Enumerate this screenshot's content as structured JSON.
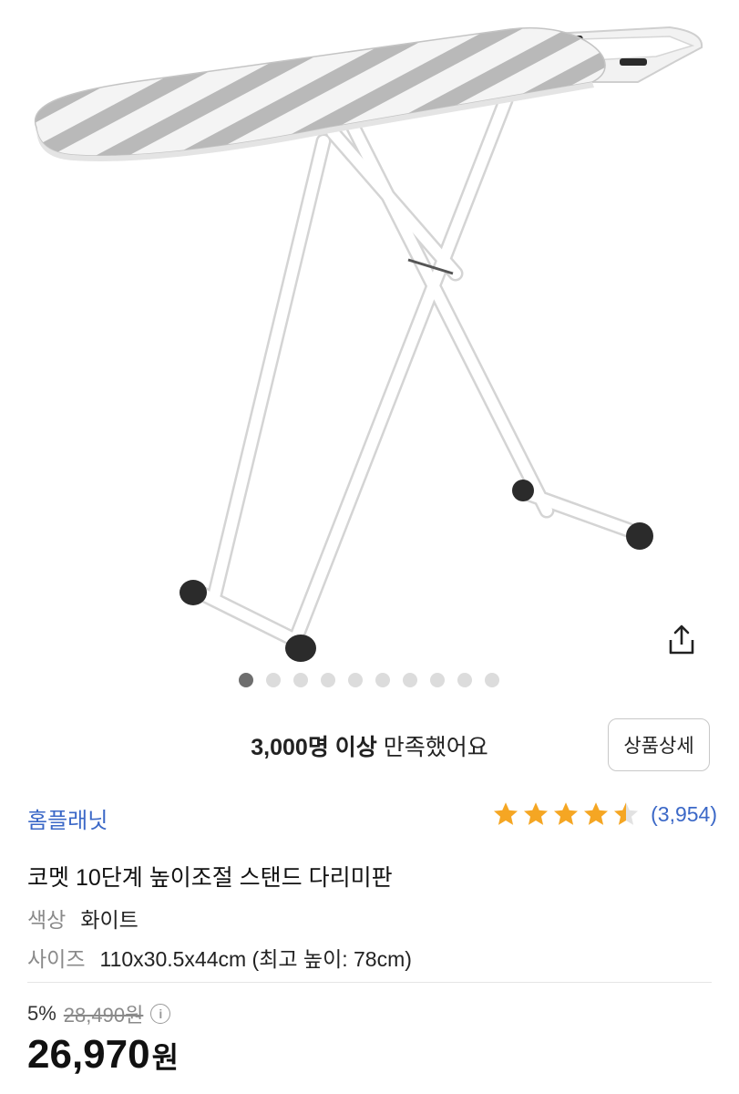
{
  "gallery": {
    "image_alt": "ironing-board-product-photo",
    "dot_count": 10,
    "active_index": 0,
    "share_icon": "share-icon"
  },
  "satisfaction": {
    "bold": "3,000명 이상",
    "rest": " 만족했어요"
  },
  "detail_button": "상품상세",
  "brand": "홈플래닛",
  "rating": {
    "score": 4.5,
    "count": "(3,954)",
    "star_color": "#f5a623"
  },
  "title": "코멧 10단계 높이조절 스탠드 다리미판",
  "options": {
    "color_label": "색상",
    "color_value": "화이트",
    "size_label": "사이즈",
    "size_value": "110x30.5x44cm (최고 높이: 78cm)"
  },
  "price": {
    "discount": "5%",
    "original": "28,490원",
    "sale_number": "26,970",
    "sale_unit": "원",
    "info_icon": "i"
  },
  "colors": {
    "brand_blue": "#3b68c7",
    "star": "#f5a623"
  }
}
